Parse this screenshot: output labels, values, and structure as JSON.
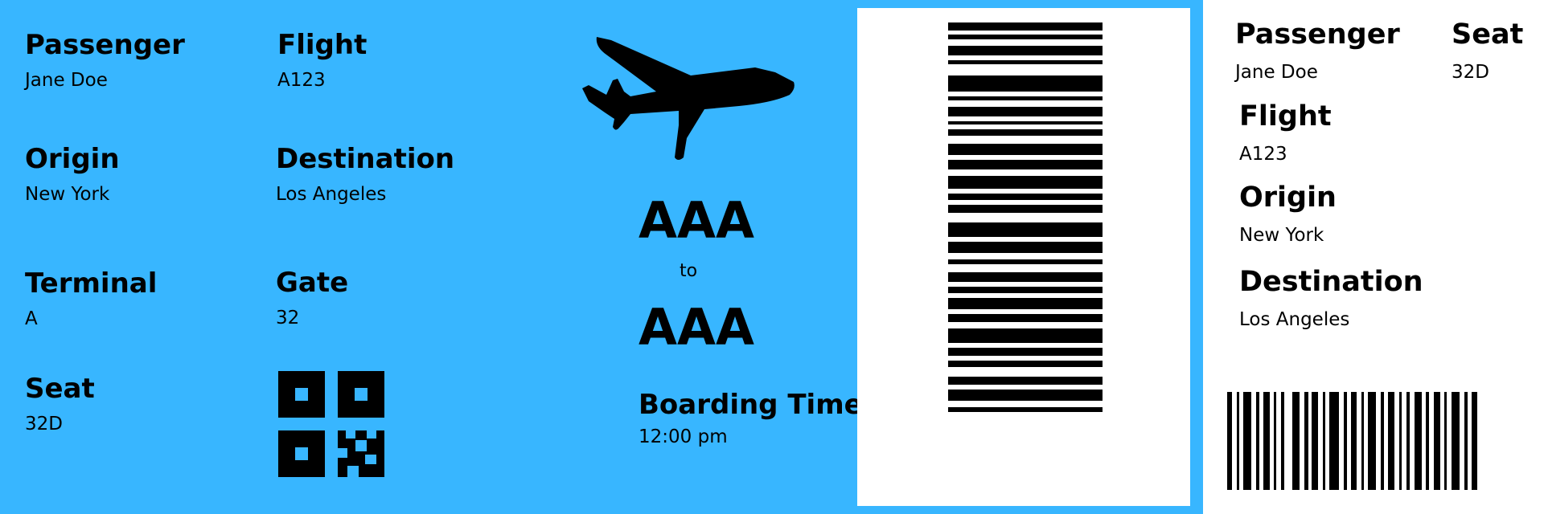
{
  "ticket": {
    "colors": {
      "main_bg": "#38b6ff",
      "stub_bg": "#ffffff",
      "ink": "#000000"
    },
    "main": {
      "passenger": {
        "label": "Passenger",
        "value": "Jane Doe"
      },
      "flight": {
        "label": "Flight",
        "value": "A123"
      },
      "origin": {
        "label": "Origin",
        "value": "New York"
      },
      "destination": {
        "label": "Destination",
        "value": "Los Angeles"
      },
      "terminal": {
        "label": "Terminal",
        "value": "A"
      },
      "gate": {
        "label": "Gate",
        "value": "32"
      },
      "seat": {
        "label": "Seat",
        "value": "32D"
      },
      "route": {
        "from_code": "AAA",
        "connector": "to",
        "to_code": "AAA"
      },
      "boarding": {
        "label": "Boarding Time",
        "value": "12:00 pm"
      },
      "icons": [
        "airplane-icon",
        "qr-code",
        "barcode"
      ]
    },
    "stub": {
      "passenger": {
        "label": "Passenger",
        "value": "Jane Doe"
      },
      "seat": {
        "label": "Seat",
        "value": "32D"
      },
      "flight": {
        "label": "Flight",
        "value": "A123"
      },
      "origin": {
        "label": "Origin",
        "value": "New York"
      },
      "destination": {
        "label": "Destination",
        "value": "Los Angeles"
      },
      "icons": [
        "barcode"
      ]
    }
  }
}
